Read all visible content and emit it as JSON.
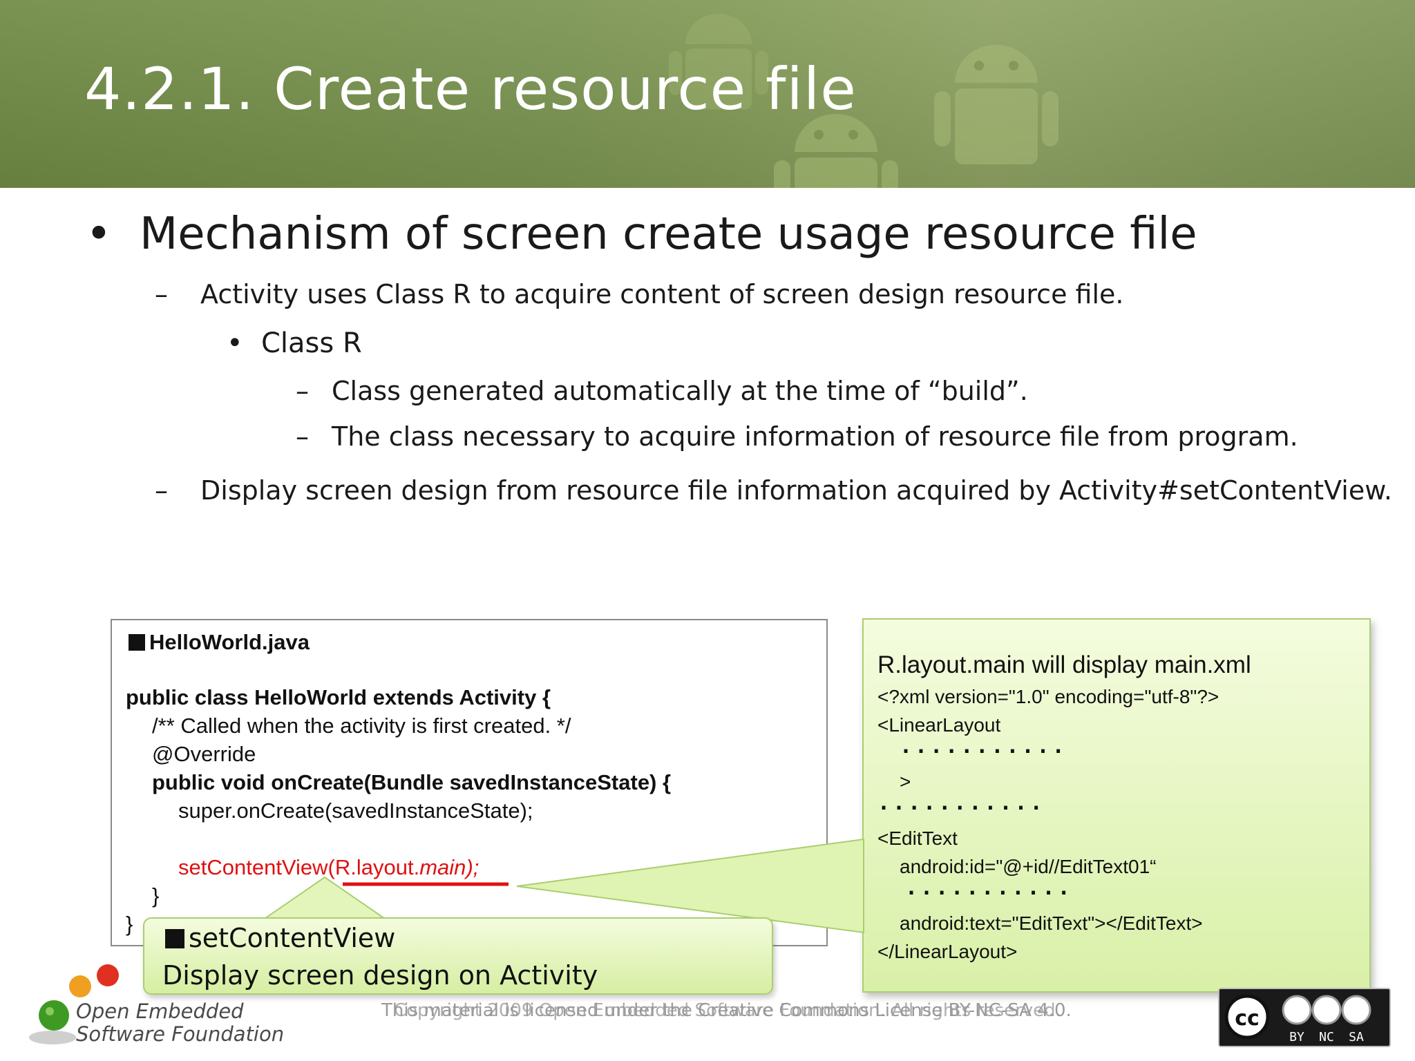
{
  "slide": {
    "title": "4.2.1. Create resource file",
    "bullets": {
      "b1_mark": "•",
      "b1": "Mechanism of screen create usage resource file",
      "dash": "–",
      "b2": "Activity uses Class R to acquire content of screen design resource file.",
      "b3_mark": "•",
      "b3": "Class R",
      "b4a": "Class generated automatically at the time of “build”.",
      "b4b": "The class necessary to acquire information of resource file from program.",
      "b5": "Display screen design from resource file information acquired by Activity#setContentView."
    }
  },
  "code": {
    "filename": "HelloWorld.java",
    "lines": [
      "public class HelloWorld extends Activity {",
      "/** Called when the activity is first created. */",
      "@Override",
      "public void onCreate(Bundle savedInstanceState) {",
      "super.onCreate(savedInstanceState);",
      "setContentView(R.layout.main);",
      "}",
      "}"
    ],
    "highlight": {
      "prefix": "setContentView(",
      "plain": "R.layout.",
      "italic": "main",
      "suffix": ");"
    }
  },
  "xml_note": {
    "heading": "R.layout.main will display main.xml",
    "lines": [
      "<?xml version=\"1.0\" encoding=\"utf-8\"?>",
      "<LinearLayout",
      ">",
      "<EditText",
      "android:id=\"@+id//EditText01“",
      "android:text=\"EditText\"></EditText>",
      "</LinearLayout>"
    ],
    "ellipsis": "..........."
  },
  "callout": {
    "title": "setContentView",
    "text": "Display screen design on Activity"
  },
  "footer": {
    "line1": "This material is licensed under the Creative Commons License BY-NC-SA 4.0.",
    "line2": "Copyright 2009 Open Embedded Software Foundation. All rights reserved.",
    "logo_line1": "Open Embedded",
    "logo_line2": "Software Foundation",
    "cc_labels": [
      "BY",
      "NC",
      "SA"
    ],
    "cc_mark": "cc"
  },
  "colors": {
    "header_green": "#7a9450",
    "code_red": "#e01010",
    "note_green": "#d9f0a8"
  }
}
